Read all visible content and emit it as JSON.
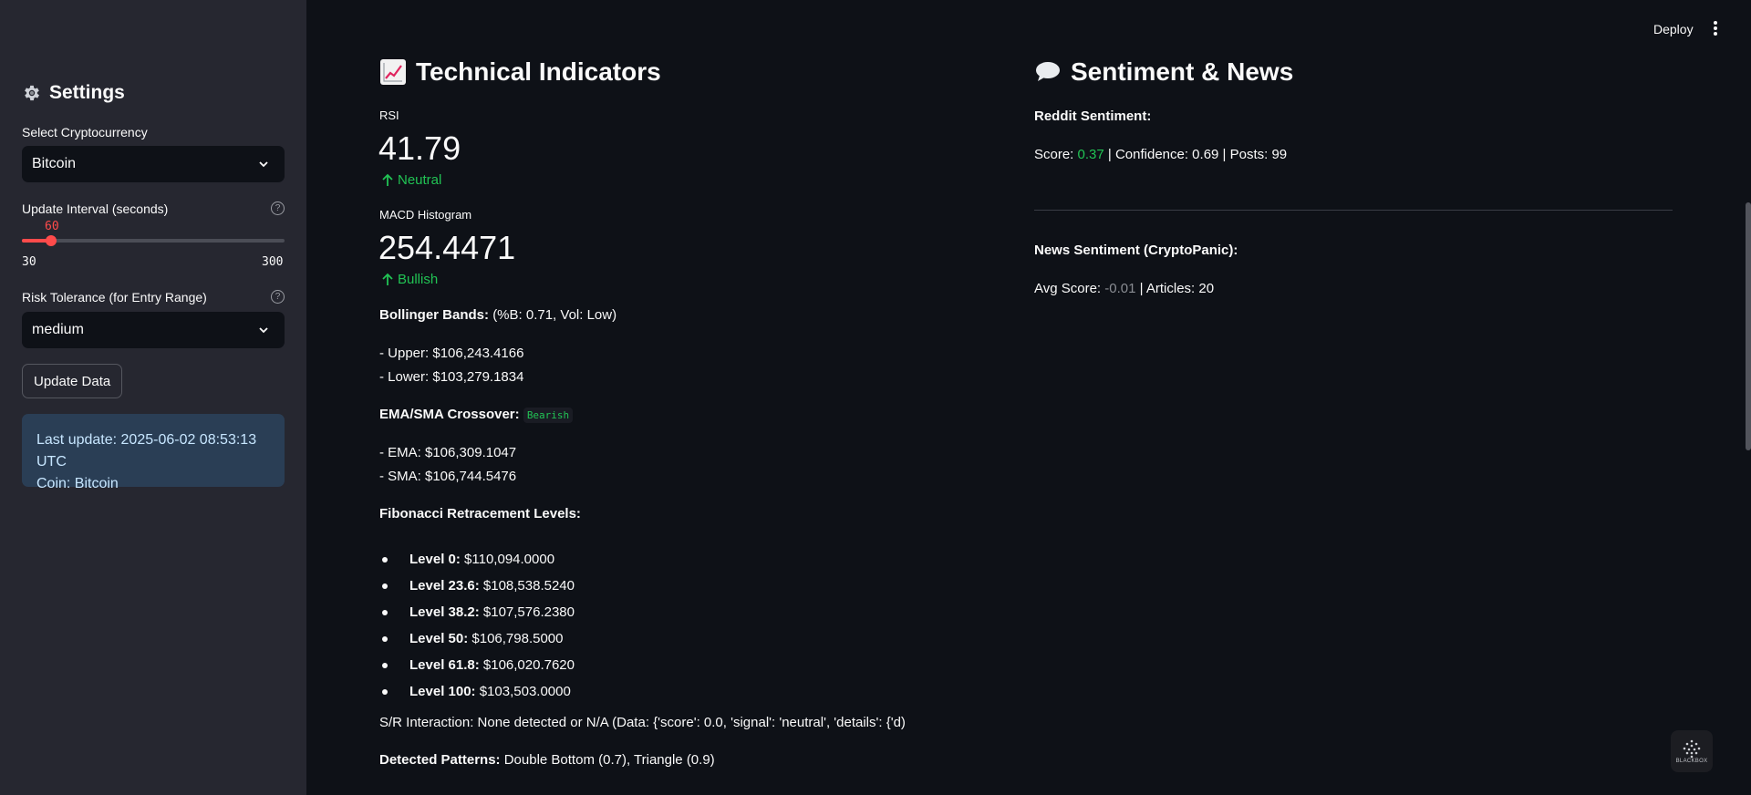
{
  "header": {
    "deploy_label": "Deploy"
  },
  "sidebar": {
    "title": "Settings",
    "crypto_label": "Select Cryptocurrency",
    "crypto_value": "Bitcoin",
    "interval_label": "Update Interval (seconds)",
    "interval_value": "60",
    "interval_min": "30",
    "interval_max": "300",
    "interval_fraction": 0.111,
    "risk_label": "Risk Tolerance (for Entry Range)",
    "risk_value": "medium",
    "update_button": "Update Data",
    "info_line1": "Last update: 2025-06-02 08:53:13 UTC",
    "info_line2": "Coin: Bitcoin",
    "help_glyph": "?"
  },
  "technical": {
    "title": "Technical Indicators",
    "rsi_label": "RSI",
    "rsi_value": "41.79",
    "rsi_delta": "Neutral",
    "macd_label": "MACD Histogram",
    "macd_value": "254.4471",
    "macd_delta": "Bullish",
    "bb_label": "Bollinger Bands:",
    "bb_detail": "(%B: 0.71, Vol: Low)",
    "bb_upper": "- Upper: $106,243.4166",
    "bb_lower": "- Lower: $103,279.1834",
    "ema_label": "EMA/SMA Crossover:",
    "ema_signal": "Bearish",
    "ema_value": "- EMA: $106,309.1047",
    "sma_value": "- SMA: $106,744.5476",
    "fib_label": "Fibonacci Retracement Levels:",
    "fib_levels": [
      {
        "name": "Level 0:",
        "value": "$110,094.0000"
      },
      {
        "name": "Level 23.6:",
        "value": "$108,538.5240"
      },
      {
        "name": "Level 38.2:",
        "value": "$107,576.2380"
      },
      {
        "name": "Level 50:",
        "value": "$106,798.5000"
      },
      {
        "name": "Level 61.8:",
        "value": "$106,020.7620"
      },
      {
        "name": "Level 100:",
        "value": "$103,503.0000"
      }
    ],
    "sr_text": "S/R Interaction: None detected or N/A (Data: {'score': 0.0, 'signal': 'neutral', 'details': {'d)",
    "patterns_label": "Detected Patterns:",
    "patterns_value": "Double Bottom (0.7), Triangle (0.9)"
  },
  "sentiment": {
    "title": "Sentiment & News",
    "reddit_label": "Reddit Sentiment:",
    "reddit_score_prefix": "Score: ",
    "reddit_score": "0.37",
    "reddit_rest": " | Confidence: 0.69 | Posts: 99",
    "news_label": "News Sentiment (CryptoPanic):",
    "news_prefix": "Avg Score: ",
    "news_score": "-0.01",
    "news_rest": " | Articles: 20"
  },
  "watermark": {
    "text": "BLACKBOX"
  },
  "colors": {
    "accent": "#ff4b4b",
    "positive": "#21c354",
    "info_bg": "#2a3e55"
  }
}
